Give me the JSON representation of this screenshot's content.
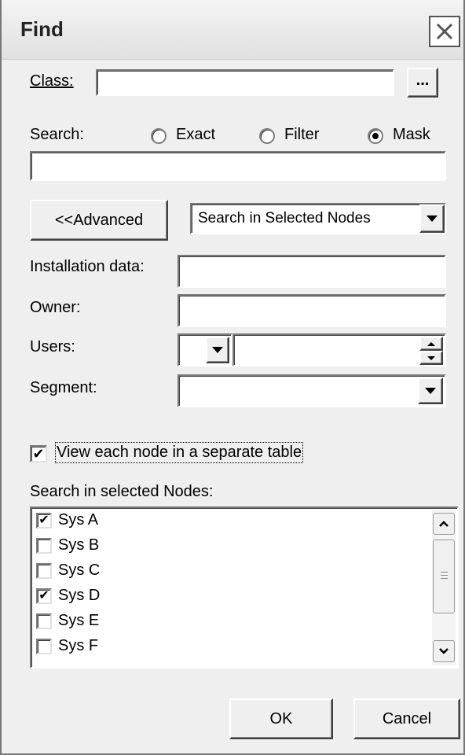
{
  "window": {
    "title": "Find"
  },
  "class_row": {
    "label": "Class:",
    "value": "",
    "browse_label": "..."
  },
  "search_row": {
    "label": "Search:",
    "options": [
      {
        "label": "Exact",
        "checked": false
      },
      {
        "label": "Filter",
        "checked": false
      },
      {
        "label": "Mask",
        "checked": true
      }
    ],
    "value": ""
  },
  "advanced_button": "<<Advanced",
  "scope_select": {
    "value": "Search in Selected Nodes"
  },
  "installation": {
    "label": "Installation data:",
    "value": ""
  },
  "owner": {
    "label": "Owner:",
    "value": ""
  },
  "users": {
    "label": "Users:",
    "operator": "",
    "value": ""
  },
  "segment": {
    "label": "Segment:",
    "value": ""
  },
  "view_separate": {
    "label": "View each node in a separate table",
    "checked": true
  },
  "nodes": {
    "label": "Search in selected Nodes:",
    "items": [
      {
        "name": "Sys A",
        "checked": true
      },
      {
        "name": "Sys B",
        "checked": false
      },
      {
        "name": "Sys C",
        "checked": false
      },
      {
        "name": "Sys D",
        "checked": true
      },
      {
        "name": "Sys E",
        "checked": false
      },
      {
        "name": "Sys F",
        "checked": false
      }
    ]
  },
  "buttons": {
    "ok": "OK",
    "cancel": "Cancel"
  },
  "icons": {
    "close": "close-icon",
    "dropdown": "chevron-down-icon",
    "scroll_up": "chevron-up-icon",
    "scroll_down": "chevron-down-icon",
    "check": "checkmark-icon"
  }
}
